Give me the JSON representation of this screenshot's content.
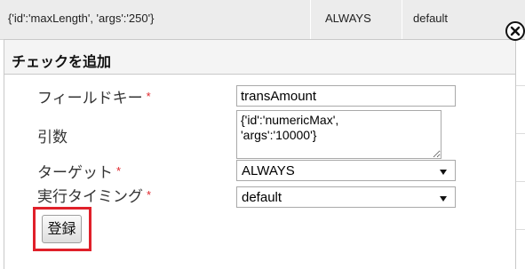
{
  "background_row": {
    "cells": [
      "{'id':'maxLength', 'args':'250'}",
      "ALWAYS",
      "default"
    ]
  },
  "dialog": {
    "title": "チェックを追加",
    "required_mark": "*",
    "fields": {
      "field_key": {
        "label": "フィールドキー",
        "value": "transAmount"
      },
      "args": {
        "label": "引数",
        "value": "{'id':'numericMax',\n'args':'10000'}"
      },
      "target": {
        "label": "ターゲット",
        "value": "ALWAYS"
      },
      "timing": {
        "label": "実行タイミング",
        "value": "default"
      }
    },
    "submit_label": "登録",
    "icons": {
      "close": "close-circle-icon",
      "dropdown": "triangle-down-icon",
      "resize": "resize-grip-icon"
    },
    "colors": {
      "required": "#e0262b",
      "highlight_box": "#e0202a"
    }
  }
}
